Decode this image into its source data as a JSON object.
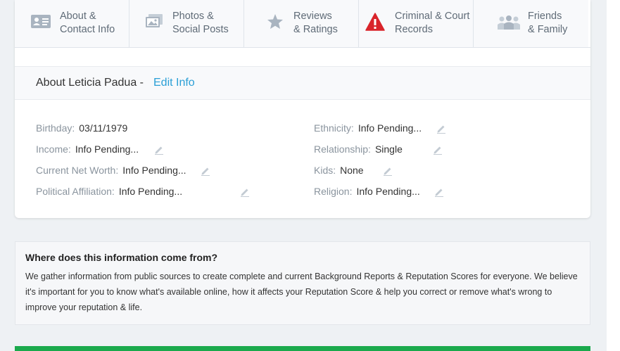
{
  "tabs": [
    {
      "label": "About &\nContact Info",
      "icon": "contact-card-icon"
    },
    {
      "label": "Photos &\nSocial Posts",
      "icon": "photos-icon"
    },
    {
      "label": "Reviews\n& Ratings",
      "icon": "star-icon"
    },
    {
      "label": "Criminal & Court\nRecords",
      "icon": "warning-icon"
    },
    {
      "label": "Friends\n& Family",
      "icon": "people-icon"
    }
  ],
  "about": {
    "title": "About Leticia Padua -",
    "edit_label": "Edit Info"
  },
  "fields_left": [
    {
      "key": "Birthday:",
      "value": "03/11/1979"
    },
    {
      "key": "Income:",
      "value": "Info Pending..."
    },
    {
      "key": "Current Net Worth:",
      "value": "Info Pending..."
    },
    {
      "key": "Political Affiliation:",
      "value": "Info Pending..."
    }
  ],
  "fields_right": [
    {
      "key": "Ethnicity:",
      "value": "Info Pending..."
    },
    {
      "key": "Relationship:",
      "value": "Single"
    },
    {
      "key": "Kids:",
      "value": "None"
    },
    {
      "key": "Religion:",
      "value": "Info Pending..."
    }
  ],
  "info": {
    "title": "Where does this information come from?",
    "text": "We gather information from public sources to create complete and current Background Reports & Reputation Scores for everyone. We believe it's important for you to know what's available online, how it affects your Reputation Score & help you correct or remove what's wrong to improve your reputation & life."
  },
  "colors": {
    "accent_link": "#2a9fd6",
    "warning_red": "#d9242b",
    "cta_green": "#1aa94c"
  }
}
